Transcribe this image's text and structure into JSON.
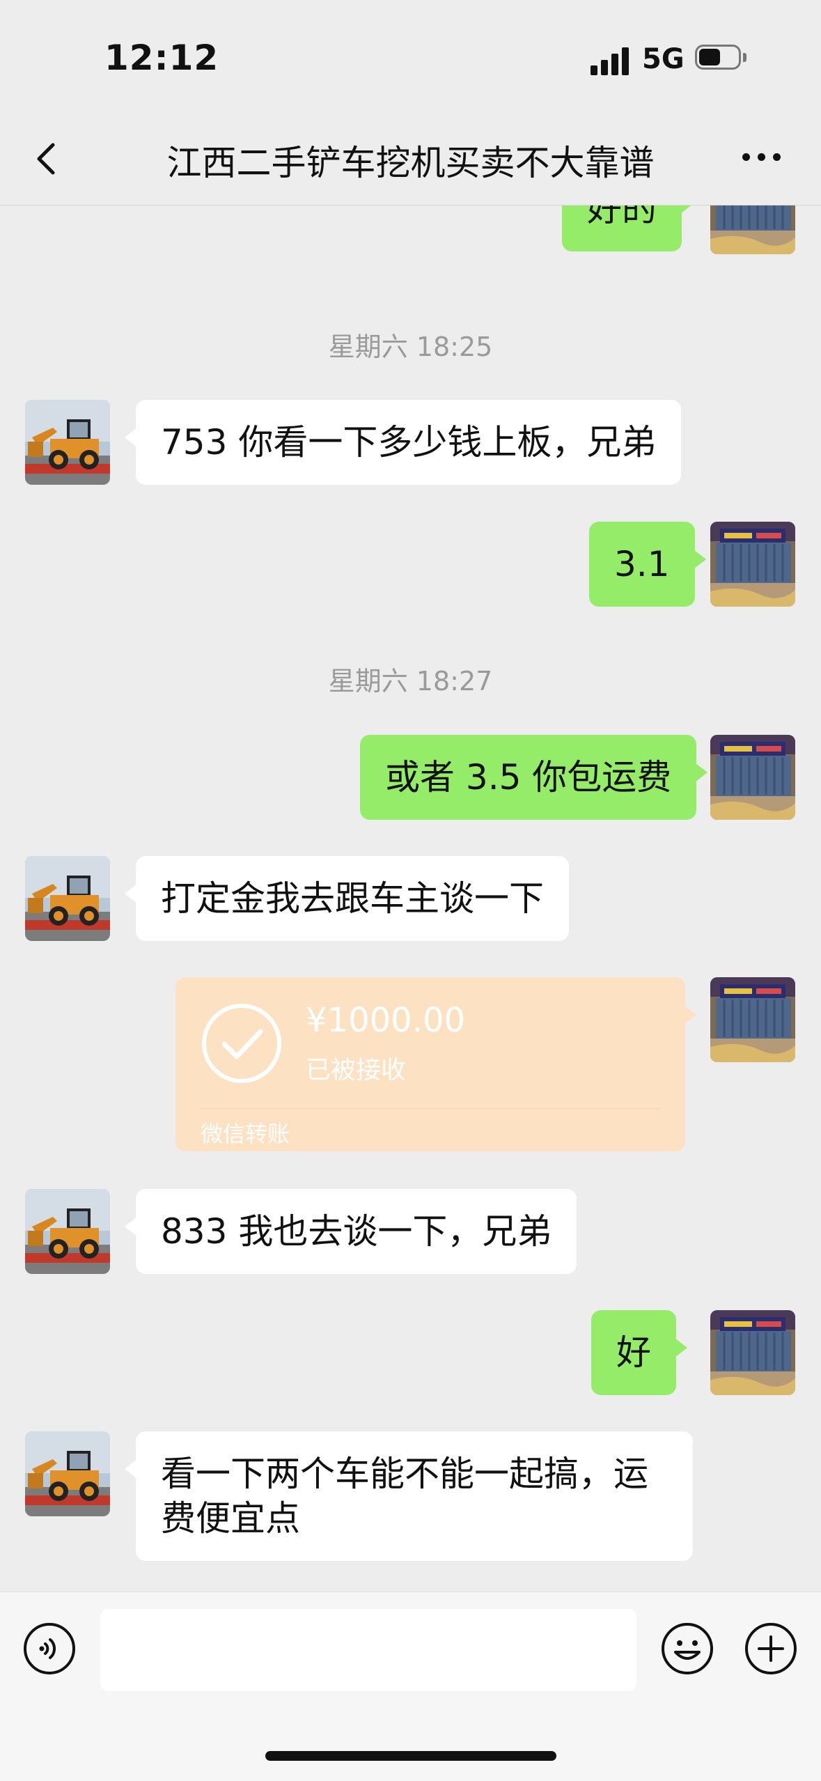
{
  "status_bar": {
    "time": "12:12",
    "network": "5G"
  },
  "nav": {
    "title": "江西二手铲车挖机买卖不大靠谱"
  },
  "colors": {
    "background": "#ededed",
    "my_bubble": "#95ec69",
    "other_bubble": "#ffffff",
    "transfer": "#fde1c3"
  },
  "messages": [
    {
      "side": "right",
      "text": "好的"
    },
    {
      "type": "timestamp",
      "text": "星期六 18:25"
    },
    {
      "side": "left",
      "text": "753 你看一下多少钱上板，兄弟"
    },
    {
      "side": "right",
      "text": "3.1"
    },
    {
      "type": "timestamp",
      "text": "星期六 18:27"
    },
    {
      "side": "right",
      "text": "或者 3.5 你包运费"
    },
    {
      "side": "left",
      "text": "打定金我去跟车主谈一下"
    },
    {
      "side": "right",
      "type": "transfer",
      "amount": "¥1000.00",
      "status": "已被接收",
      "caption": "微信转账"
    },
    {
      "side": "left",
      "text": "833 我也去谈一下，兄弟"
    },
    {
      "side": "right",
      "text": "好"
    },
    {
      "side": "left",
      "text": "看一下两个车能不能一起搞，运费便宜点"
    }
  ],
  "avatars": {
    "me": "container-truck-photo",
    "other": "loader-on-trailer-photo"
  },
  "icons": {
    "back": "chevron-left-icon",
    "more": "more-dots-icon",
    "voice": "voice-icon",
    "emoji": "emoji-icon",
    "plus": "plus-icon",
    "transfer": "check-circle-icon"
  },
  "input": {
    "value": ""
  }
}
